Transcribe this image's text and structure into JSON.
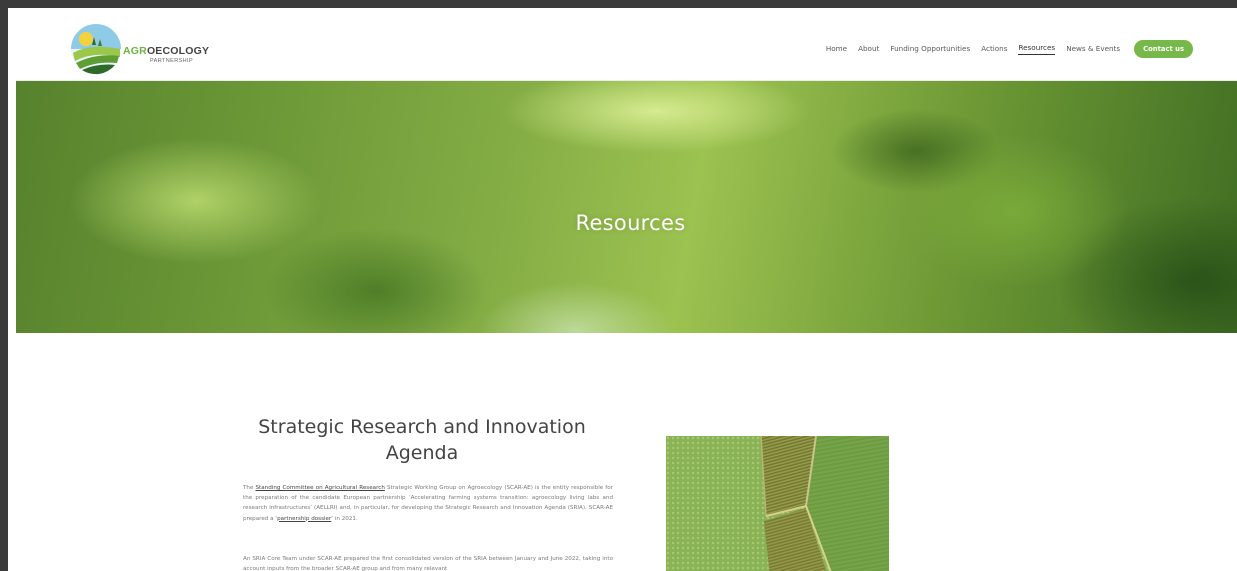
{
  "brand": {
    "name_part1": "AGR",
    "name_part2": "OECOLOGY",
    "subtitle": "PARTNERSHIP"
  },
  "nav": {
    "items": [
      {
        "label": "Home",
        "active": false
      },
      {
        "label": "About",
        "active": false
      },
      {
        "label": "Funding Opportunities",
        "active": false
      },
      {
        "label": "Actions",
        "active": false
      },
      {
        "label": "Resources",
        "active": true
      },
      {
        "label": "News & Events",
        "active": false
      }
    ],
    "cta_label": "Contact us"
  },
  "hero": {
    "title": "Resources"
  },
  "section": {
    "title": "Strategic Research and Innovation Agenda",
    "p1": {
      "prefix": "The ",
      "link1": "Standing Committee on Agricultural Research",
      "middle": " Strategic Working Group on Agroecology (SCAR-AE) is the entity responsible for the preparation of the candidate European partnership ‘Accelerating farming systems transition: agroecology living labs and research infrastructures’ (AELLRI) and, in particular, for developing the Strategic Research and Innovation Agenda (SRIA). SCAR-AE prepared a ‘",
      "link2": "partnership dossier",
      "suffix": "’ in 2021."
    },
    "p2": "An SRIA Core Team under SCAR-AE prepared the first consolidated version of the SRIA between January and June 2022, taking into account inputs from the broader SCAR-AE group and from many relevant"
  },
  "colors": {
    "accent": "#77b84a",
    "text": "#444444",
    "muted": "#7a7a7a"
  }
}
